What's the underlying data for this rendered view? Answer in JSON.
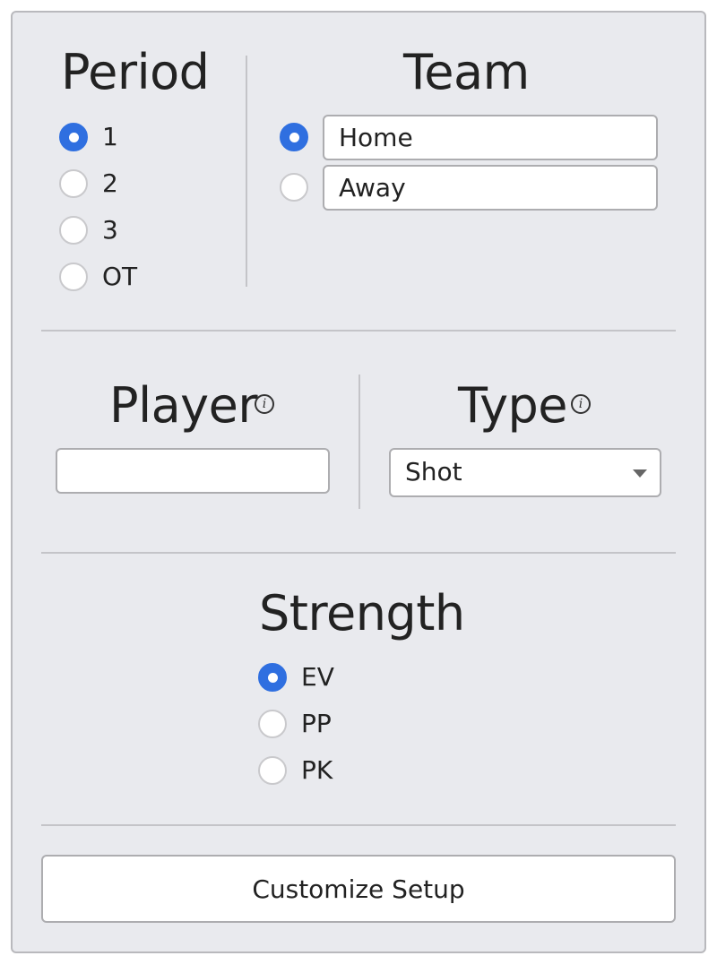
{
  "period": {
    "title": "Period",
    "options": [
      {
        "label": "1",
        "checked": true
      },
      {
        "label": "2",
        "checked": false
      },
      {
        "label": "3",
        "checked": false
      },
      {
        "label": "OT",
        "checked": false
      }
    ]
  },
  "team": {
    "title": "Team",
    "options": [
      {
        "value": "Home",
        "checked": true
      },
      {
        "value": "Away",
        "checked": false
      }
    ]
  },
  "player": {
    "title": "Player",
    "info_glyph": "i",
    "value": ""
  },
  "type": {
    "title": "Type",
    "info_glyph": "i",
    "selected": "Shot"
  },
  "strength": {
    "title": "Strength",
    "options": [
      {
        "label": "EV",
        "checked": true
      },
      {
        "label": "PP",
        "checked": false
      },
      {
        "label": "PK",
        "checked": false
      }
    ]
  },
  "actions": {
    "customize_label": "Customize Setup"
  },
  "colors": {
    "accent": "#2f6fe0",
    "panel_bg": "#e9eaee",
    "border": "#b9b9bd"
  }
}
